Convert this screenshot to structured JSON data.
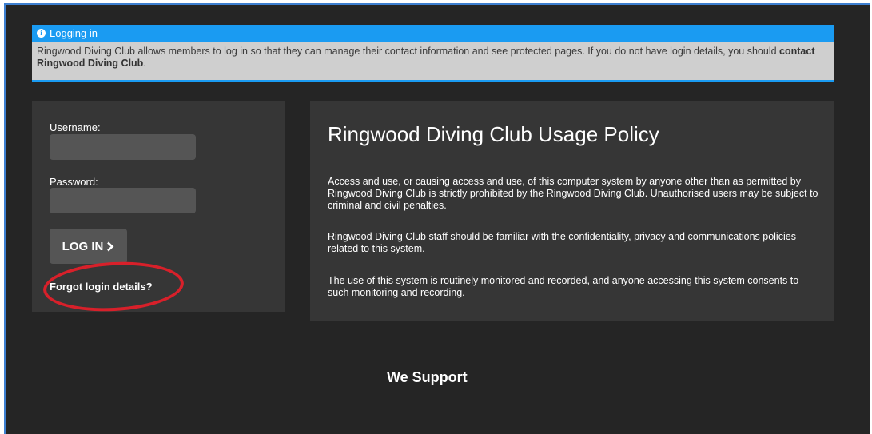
{
  "notice": {
    "title": "Logging in",
    "body_text": "Ringwood Diving Club allows members to log in so that they can manage their contact information and see protected pages. If you do not have login details, you should ",
    "body_link": "contact Ringwood Diving Club",
    "body_end": "."
  },
  "login": {
    "username_label": "Username:",
    "username_value": "",
    "password_label": "Password:",
    "password_value": "",
    "button_label": "LOG IN",
    "button_icon": "chevron-right-icon",
    "forgot_label": "Forgot login details?"
  },
  "policy": {
    "title": "Ringwood Diving Club Usage Policy",
    "paragraphs": [
      "Access and use, or causing access and use, of this computer system by anyone other than as permitted by Ringwood Diving Club is strictly prohibited by the Ringwood Diving Club. Unauthorised users may be subject to criminal and civil penalties.",
      "Ringwood Diving Club staff should be familiar with the confidentiality, privacy and communications policies related to this system.",
      "The use of this system is routinely monitored and recorded, and anyone accessing this system consents to such monitoring and recording."
    ]
  },
  "footer": {
    "we_support": "We Support"
  },
  "colors": {
    "background": "#252525",
    "panel": "#363636",
    "accent_blue": "#1a9bf2",
    "highlight_red": "#d8202a"
  }
}
